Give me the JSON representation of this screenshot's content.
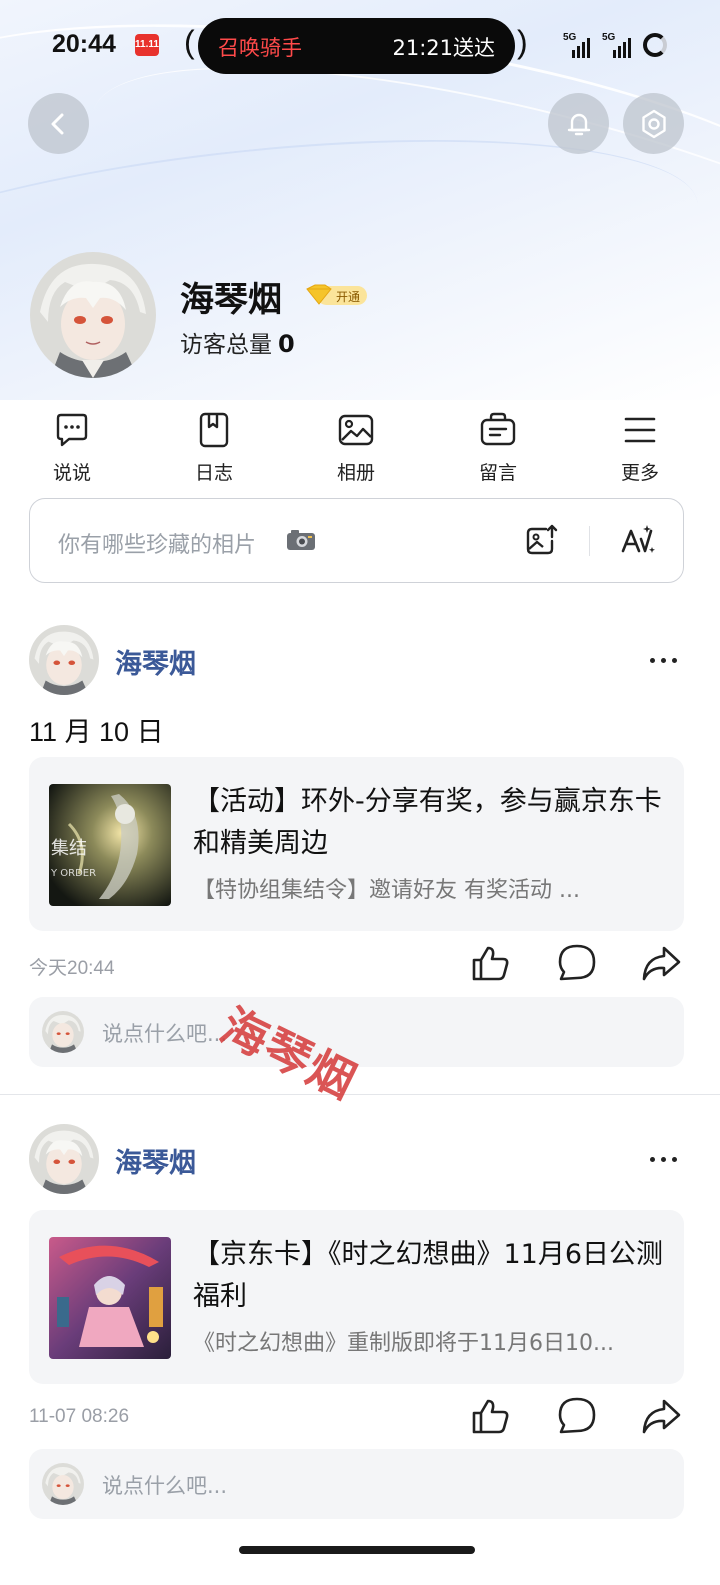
{
  "status_bar": {
    "time": "20:44",
    "app_badge": "11.11",
    "pill_left": "召唤骑手",
    "pill_right": "21:21送达",
    "signal_1": "5G",
    "signal_2": "5G"
  },
  "profile": {
    "name": "海琴烟",
    "vip_label": "开通",
    "visits_label": "访客总量",
    "visits_count": "0"
  },
  "nav": [
    {
      "label": "说说",
      "icon": "chat-bubble-icon"
    },
    {
      "label": "日志",
      "icon": "notebook-icon"
    },
    {
      "label": "相册",
      "icon": "photo-icon"
    },
    {
      "label": "留言",
      "icon": "message-board-icon"
    },
    {
      "label": "更多",
      "icon": "menu-icon"
    }
  ],
  "composer": {
    "placeholder": "你有哪些珍藏的相片"
  },
  "posts": [
    {
      "author": "海琴烟",
      "date": "11 月 10 日",
      "card_title": "【活动】环外-分享有奖，参与赢京东卡和精美周边",
      "card_desc": "【特协组集结令】邀请好友 有奖活动 ...",
      "time": "今天20:44",
      "comment_placeholder": "说点什么吧..."
    },
    {
      "author": "海琴烟",
      "card_title": "【京东卡】《时之幻想曲》11月6日公测福利",
      "card_desc": "《时之幻想曲》重制版即将于11月6日10...",
      "time": "11-07 08:26",
      "comment_placeholder": "说点什么吧..."
    }
  ],
  "watermark": "海琴烟",
  "colors": {
    "author_blue": "#3b5998",
    "pill_red": "#ff4a4a"
  }
}
